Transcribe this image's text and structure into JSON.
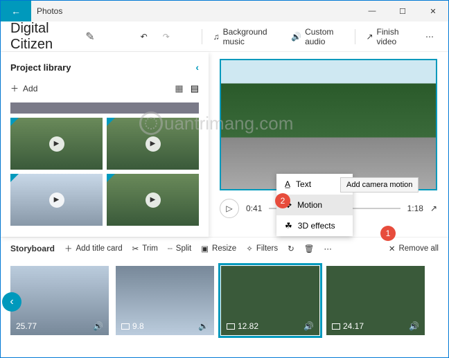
{
  "window": {
    "app": "Photos"
  },
  "project": {
    "name": "Digital Citizen"
  },
  "toolbar": {
    "bg_music": "Background music",
    "custom_audio": "Custom audio",
    "finish": "Finish video"
  },
  "library": {
    "title": "Project library",
    "add": "Add"
  },
  "player": {
    "current": "0:41",
    "total": "1:18"
  },
  "context_menu": {
    "text": "Text",
    "motion": "Motion",
    "effects": "3D effects",
    "tooltip": "Add camera motion"
  },
  "badges": {
    "one": "1",
    "two": "2"
  },
  "storybar": {
    "title": "Storyboard",
    "add_title": "Add title card",
    "trim": "Trim",
    "split": "Split",
    "resize": "Resize",
    "filters": "Filters",
    "remove": "Remove all"
  },
  "clips": [
    {
      "duration": "25.77"
    },
    {
      "duration": "9.8"
    },
    {
      "duration": "12.82"
    },
    {
      "duration": "24.17"
    }
  ],
  "watermark": "uantrimang.com"
}
